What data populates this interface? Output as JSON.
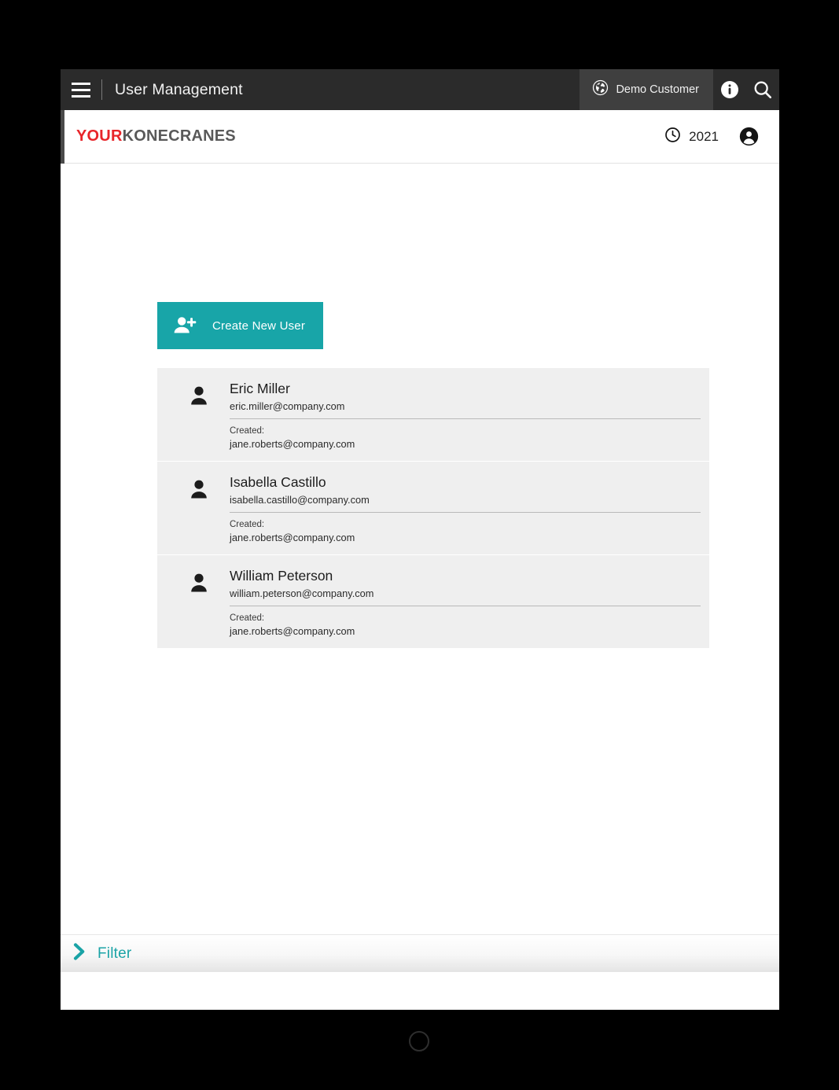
{
  "app_bar": {
    "menu_icon": "hamburger-menu-icon",
    "title": "User Management",
    "customer": {
      "icon": "globe-icon",
      "label": "Demo Customer"
    },
    "info_icon": "info-icon",
    "search_icon": "search-icon"
  },
  "logo_bar": {
    "brand_first": "YOUR",
    "brand_second": "KONECRANES",
    "year": {
      "icon": "clock-icon",
      "label": "2021"
    },
    "account_icon": "account-circle-icon"
  },
  "content": {
    "create_button": {
      "icon": "person-add-icon",
      "label": "Create New User"
    },
    "created_label": "Created:",
    "users": [
      {
        "avatar_icon": "person-icon",
        "name": "Eric Miller",
        "email": "eric.miller@company.com",
        "created_by": "jane.roberts@company.com"
      },
      {
        "avatar_icon": "person-icon",
        "name": "Isabella Castillo",
        "email": "isabella.castillo@company.com",
        "created_by": "jane.roberts@company.com"
      },
      {
        "avatar_icon": "person-icon",
        "name": "William Peterson",
        "email": "william.peterson@company.com",
        "created_by": "jane.roberts@company.com"
      }
    ]
  },
  "filter_bar": {
    "icon": "chevron-right-icon",
    "label": "Filter"
  },
  "colors": {
    "accent_teal": "#18a5a8",
    "brand_red": "#e8252a",
    "brand_gray": "#595959",
    "app_bar_bg": "#2b2b2b",
    "chip_bg": "#3f3f3f",
    "card_bg": "#efefef"
  }
}
